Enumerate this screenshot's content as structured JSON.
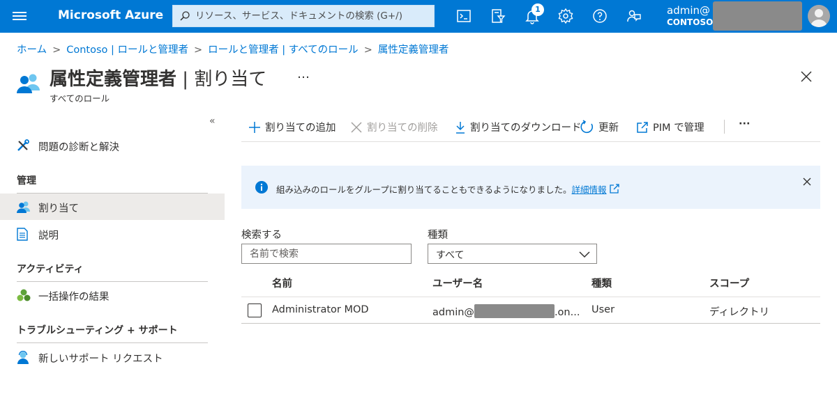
{
  "topbar": {
    "brand": "Microsoft Azure",
    "search_placeholder": "リソース、サービス、ドキュメントの検索 (G+/)",
    "notification_count": "1",
    "account_name": "admin@",
    "account_tenant": "CONTOSO",
    "icons": [
      "cloud-shell-icon",
      "directory-filter-icon",
      "notifications-icon",
      "settings-icon",
      "help-icon",
      "feedback-icon"
    ],
    "accent_color": "#0078d4"
  },
  "breadcrumb": [
    "ホーム",
    "Contoso | ロールと管理者",
    "ロールと管理者 | すべてのロール",
    "属性定義管理者"
  ],
  "header": {
    "title_bold": "属性定義管理者",
    "title_rest": " | 割り当て",
    "more": "…",
    "subtitle": "すべてのロール"
  },
  "sidebar": {
    "collapse": "«",
    "diagnose": "問題の診断と解決",
    "sections": [
      {
        "heading": "管理",
        "items": [
          "割り当て",
          "説明"
        ]
      },
      {
        "heading": "アクティビティ",
        "items": [
          "一括操作の結果"
        ]
      },
      {
        "heading": "トラブルシューティング + サポート",
        "items": [
          "新しいサポート リクエスト"
        ]
      }
    ],
    "selected": "割り当て"
  },
  "commands": {
    "add": "割り当ての追加",
    "remove": "割り当ての削除",
    "download": "割り当てのダウンロード",
    "refresh": "更新",
    "pim": "PIM で管理",
    "more": "···"
  },
  "banner": {
    "text": "組み込みのロールをグループに割り当てることもできるようになりました。",
    "link": "詳細情報"
  },
  "filters": {
    "search_label": "検索する",
    "search_placeholder": "名前で検索",
    "type_label": "種類",
    "type_value": "すべて"
  },
  "table": {
    "columns": [
      "名前",
      "ユーザー名",
      "種類",
      "スコープ"
    ],
    "rows": [
      {
        "name": "Administrator MOD",
        "username_prefix": "admin@",
        "username_suffix": ".on...",
        "type": "User",
        "scope": "ディレクトリ"
      }
    ]
  }
}
